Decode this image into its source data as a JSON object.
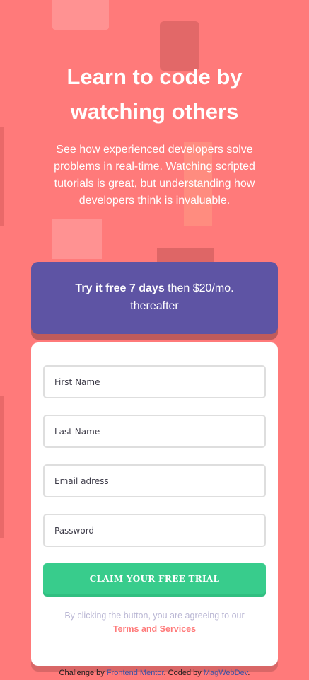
{
  "hero": {
    "title": "Learn to code by watching others",
    "description": "See how experienced developers solve problems in real-time. Watching scripted tutorials is great, but understanding how developers think is invaluable."
  },
  "promo": {
    "bold": "Try it free 7 days",
    "rest": " then $20/mo. thereafter"
  },
  "form": {
    "first_name_placeholder": "First Name",
    "last_name_placeholder": "Last Name",
    "email_placeholder": "Email adress",
    "password_placeholder": "Password",
    "cta_label": "CLAIM YOUR FREE TRIAL",
    "terms_prefix": "By clicking the button, you are agreeing to our",
    "terms_link": "Terms and Services"
  },
  "attribution": {
    "prefix": "Challenge by ",
    "challenge_link": "Frontend Mentor",
    "middle": ". Coded by ",
    "author_link": "MagWebDev",
    "suffix": "."
  },
  "colors": {
    "background": "#ff7a7a",
    "promo": "#5e54a4",
    "cta": "#38cc8c"
  }
}
